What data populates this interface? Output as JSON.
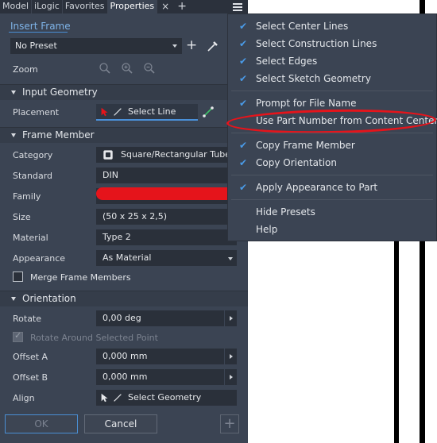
{
  "tabs": [
    {
      "label": "Model",
      "active": false
    },
    {
      "label": "iLogic",
      "active": false
    },
    {
      "label": "Favorites",
      "active": false
    },
    {
      "label": "Properties",
      "active": true
    }
  ],
  "tab_close": "×",
  "tab_add": "+",
  "insert_frame": "Insert Frame",
  "preset": {
    "value": "No Preset",
    "add": "+"
  },
  "zoom_label": "Zoom",
  "sections": {
    "input_geometry": "Input Geometry",
    "frame_member": "Frame Member",
    "orientation": "Orientation"
  },
  "placement": {
    "label": "Placement",
    "value": "Select Line"
  },
  "frame_member": {
    "category": {
      "label": "Category",
      "value": "Square/Rectangular Tubes"
    },
    "standard": {
      "label": "Standard",
      "value": "DIN"
    },
    "family": {
      "label": "Family",
      "value": ""
    },
    "size": {
      "label": "Size",
      "value": "(50 x 25 x 2,5)"
    },
    "material": {
      "label": "Material",
      "value": "Type 2"
    },
    "appearance": {
      "label": "Appearance",
      "value": "As Material"
    },
    "merge": {
      "label": "Merge Frame Members",
      "checked": false
    }
  },
  "orientation": {
    "rotate": {
      "label": "Rotate",
      "value": "0,00 deg"
    },
    "rotate_around": {
      "label": "Rotate Around Selected Point",
      "checked": true,
      "disabled": true
    },
    "offset_a": {
      "label": "Offset A",
      "value": "0,000 mm"
    },
    "offset_b": {
      "label": "Offset B",
      "value": "0,000 mm"
    },
    "align": {
      "label": "Align",
      "value": "Select Geometry"
    }
  },
  "buttons": {
    "ok": "OK",
    "cancel": "Cancel",
    "plus": "+"
  },
  "menu": {
    "items": [
      {
        "label": "Select Center Lines",
        "checked": true
      },
      {
        "label": "Select Construction Lines",
        "checked": true
      },
      {
        "label": "Select Edges",
        "checked": true
      },
      {
        "label": "Select Sketch Geometry",
        "checked": true
      },
      {
        "label": "Prompt for File Name",
        "checked": true
      },
      {
        "label": "Use Part Number from Content Center",
        "checked": false
      },
      {
        "label": "Copy Frame Member",
        "checked": true
      },
      {
        "label": "Copy Orientation",
        "checked": true
      },
      {
        "label": "Apply Appearance to Part",
        "checked": true
      },
      {
        "label": "Hide Presets",
        "checked": false
      },
      {
        "label": "Help",
        "checked": false
      }
    ],
    "check_glyph": "✔"
  },
  "colors": {
    "panel_bg": "#3b4453",
    "accent": "#4a9be8",
    "annotation_red": "#e5141b"
  }
}
